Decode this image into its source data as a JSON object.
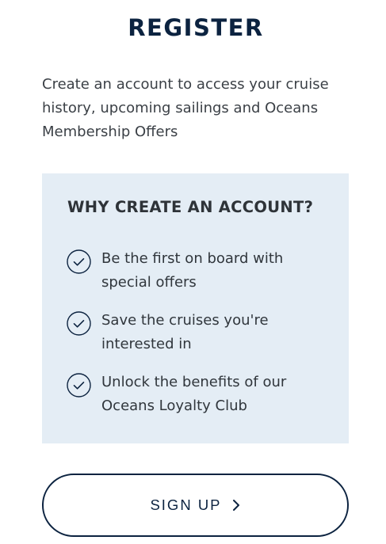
{
  "header": {
    "title": "REGISTER"
  },
  "intro": {
    "text": "Create an account to access your cruise history, upcoming sailings and Oceans Membership Offers"
  },
  "benefits": {
    "heading": "WHY CREATE AN ACCOUNT?",
    "items": [
      {
        "icon": "check-circle-icon",
        "text": "Be the first on board with special offers"
      },
      {
        "icon": "check-circle-icon",
        "text": "Save the cruises you're interested in"
      },
      {
        "icon": "check-circle-icon",
        "text": "Unlock the benefits of our Oceans Loyalty Club"
      }
    ]
  },
  "cta": {
    "label": "SIGN UP",
    "icon": "chevron-right-icon"
  },
  "colors": {
    "brand_navy": "#0c2340",
    "panel_background": "#e4edf5",
    "body_text": "#3b4046"
  }
}
